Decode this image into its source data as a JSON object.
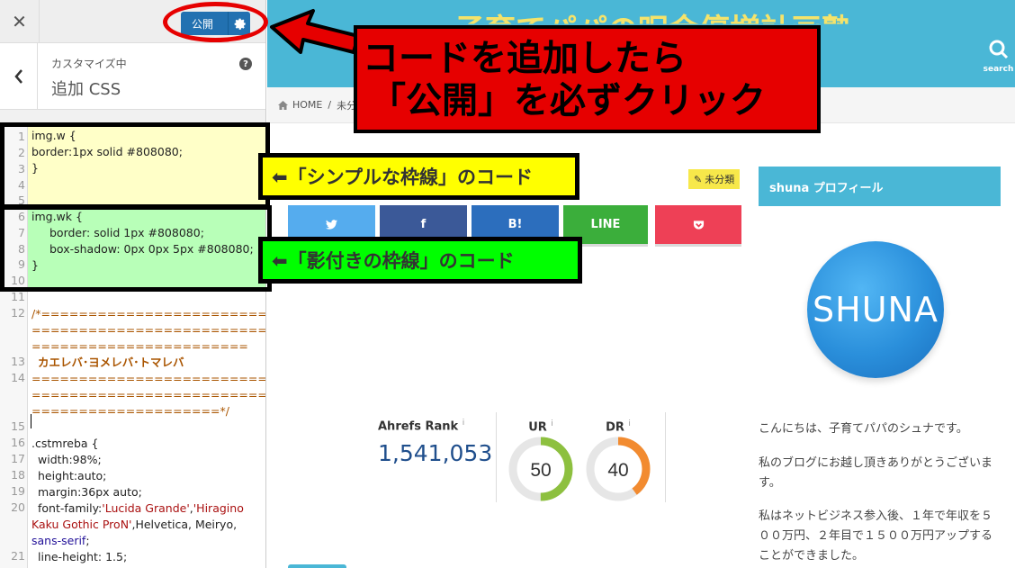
{
  "customizer": {
    "close_icon": "close-icon",
    "publish_label": "公開",
    "publish_gear_icon": "gear-icon",
    "section_subtitle": "カスタマイズ中",
    "section_title": "追加 CSS",
    "back_icon": "chevron-left-icon",
    "help_icon": "question-icon",
    "help_glyph": "?"
  },
  "editor": {
    "lines": [
      {
        "n": "1",
        "text": "img.w {"
      },
      {
        "n": "2",
        "text": "border:1px solid #808080;"
      },
      {
        "n": "3",
        "text": "}"
      },
      {
        "n": "4",
        "text": ""
      },
      {
        "n": "5",
        "text": ""
      },
      {
        "n": "6",
        "text": "img.wk {"
      },
      {
        "n": "7",
        "text": "border: solid 1px #808080;"
      },
      {
        "n": "8",
        "text": "box-shadow: 0px 0px 5px #808080;"
      },
      {
        "n": "9",
        "text": "}"
      },
      {
        "n": "10",
        "text": ""
      },
      {
        "n": "11",
        "text": ""
      },
      {
        "n": "12",
        "text": "/*========================================================================="
      },
      {
        "n": "13",
        "text": "カエレバ･ヨメレバ･トマレバ"
      },
      {
        "n": "14",
        "text": "=======================================================================*/"
      },
      {
        "n": "15",
        "text": ""
      },
      {
        "n": "16",
        "text": ".cstmreba {"
      },
      {
        "n": "17",
        "text": "width:98%;"
      },
      {
        "n": "18",
        "text": "height:auto;"
      },
      {
        "n": "19",
        "text": "margin:36px auto;"
      },
      {
        "n": "20",
        "text": "font-family:'Lucida Grande','Hiragino Kaku Gothic ProN',Helvetica, Meiryo, sans-serif;"
      },
      {
        "n": "21",
        "text": "line-height: 1.5;"
      }
    ],
    "row12a": "/*===========================",
    "row12b": "===========================",
    "row12c": "=======================",
    "row14a": "===========================",
    "row14b": "===========================",
    "row14c": "====================*/",
    "row20a": "font-family:",
    "row20b": "'Lucida Grande'",
    "row20c": "'Hiragino",
    "row20d": "Kaku Gothic ProN'",
    "row20e": ",Helvetica, Meiryo,",
    "row20f": "sans-serif"
  },
  "site": {
    "title": "子育てパパの呪金停増計画塾",
    "search_label": "search",
    "search_icon": "search-icon",
    "breadcrumb_home": "HOME",
    "breadcrumb_sep": "/",
    "breadcrumb_cat": "未分",
    "category_badge": "未分類",
    "share_buttons": [
      {
        "label": "",
        "icon": "twitter-icon",
        "color": "#55acee"
      },
      {
        "label": "f",
        "icon": "facebook-icon",
        "color": "#3b5998"
      },
      {
        "label": "B!",
        "icon": "hatena-icon",
        "color": "#2c6ebd"
      },
      {
        "label": "LINE",
        "icon": "line-icon",
        "color": "#3bae3b"
      },
      {
        "label": "",
        "icon": "pocket-icon",
        "color": "#ee4056"
      }
    ],
    "ahrefs": {
      "label": "Ahrefs Rank",
      "sup": "i",
      "value": "1,541,053"
    },
    "ur": {
      "label": "UR",
      "sup": "i",
      "value": 50,
      "color": "#8dc03f"
    },
    "dr": {
      "label": "DR",
      "sup": "i",
      "value": 40,
      "color": "#f28b30"
    },
    "profile_header": "shuna プロフィール",
    "avatar_text": "SHUNA",
    "profile_p1": "こんにちは、子育てパパのシュナです。",
    "profile_p2": "私のブログにお越し頂きありがとうございます。",
    "profile_p3": "私はネットビジネス参入後、１年で年収を５００万円、２年目で１５００万円アップすることができました。"
  },
  "annotations": {
    "publish_note_line1": "コードを追加したら",
    "publish_note_line2": "「公開」を必ずクリック",
    "simple_border_note": "⬅「シンプルな枠線」のコード",
    "shadow_border_note": "⬅「影付きの枠線」のコード",
    "colors": {
      "red": "#e60000",
      "yellow": "#ffff00",
      "green": "#00ff00",
      "code_yellow": "#ffffc8",
      "code_green": "#b8ffb8"
    }
  }
}
